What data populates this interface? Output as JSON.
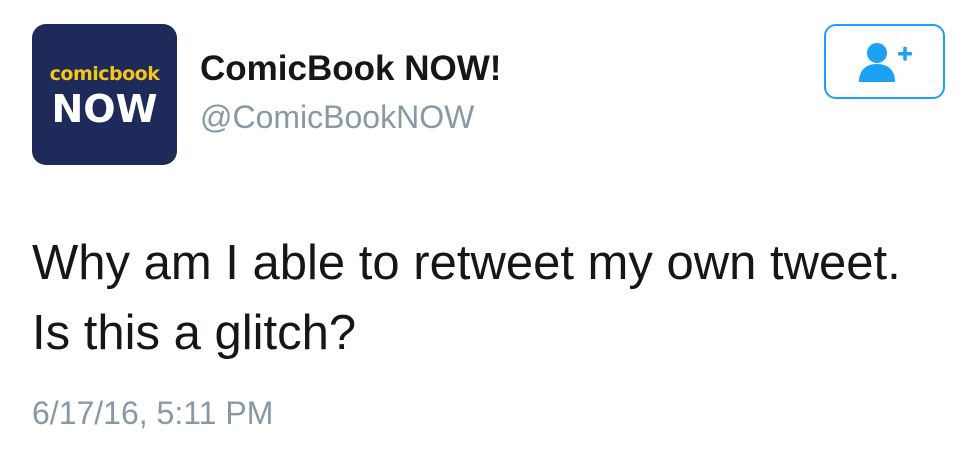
{
  "profile": {
    "avatar_text_top": "comicbook",
    "avatar_text_bottom": "NOW",
    "display_name": "ComicBook NOW!",
    "handle": "@ComicBookNOW"
  },
  "follow_button": {
    "icon": "add-user-icon",
    "color": "#1da1f2"
  },
  "tweet": {
    "text": "Why am I able to retweet my own tweet. Is this a glitch?",
    "timestamp": "6/17/16, 5:11 PM"
  },
  "colors": {
    "avatar_bg": "#1d2a5a",
    "avatar_accent": "#f5c518",
    "text_primary": "#14171a",
    "text_secondary": "#8899a6",
    "accent": "#1da1f2"
  }
}
